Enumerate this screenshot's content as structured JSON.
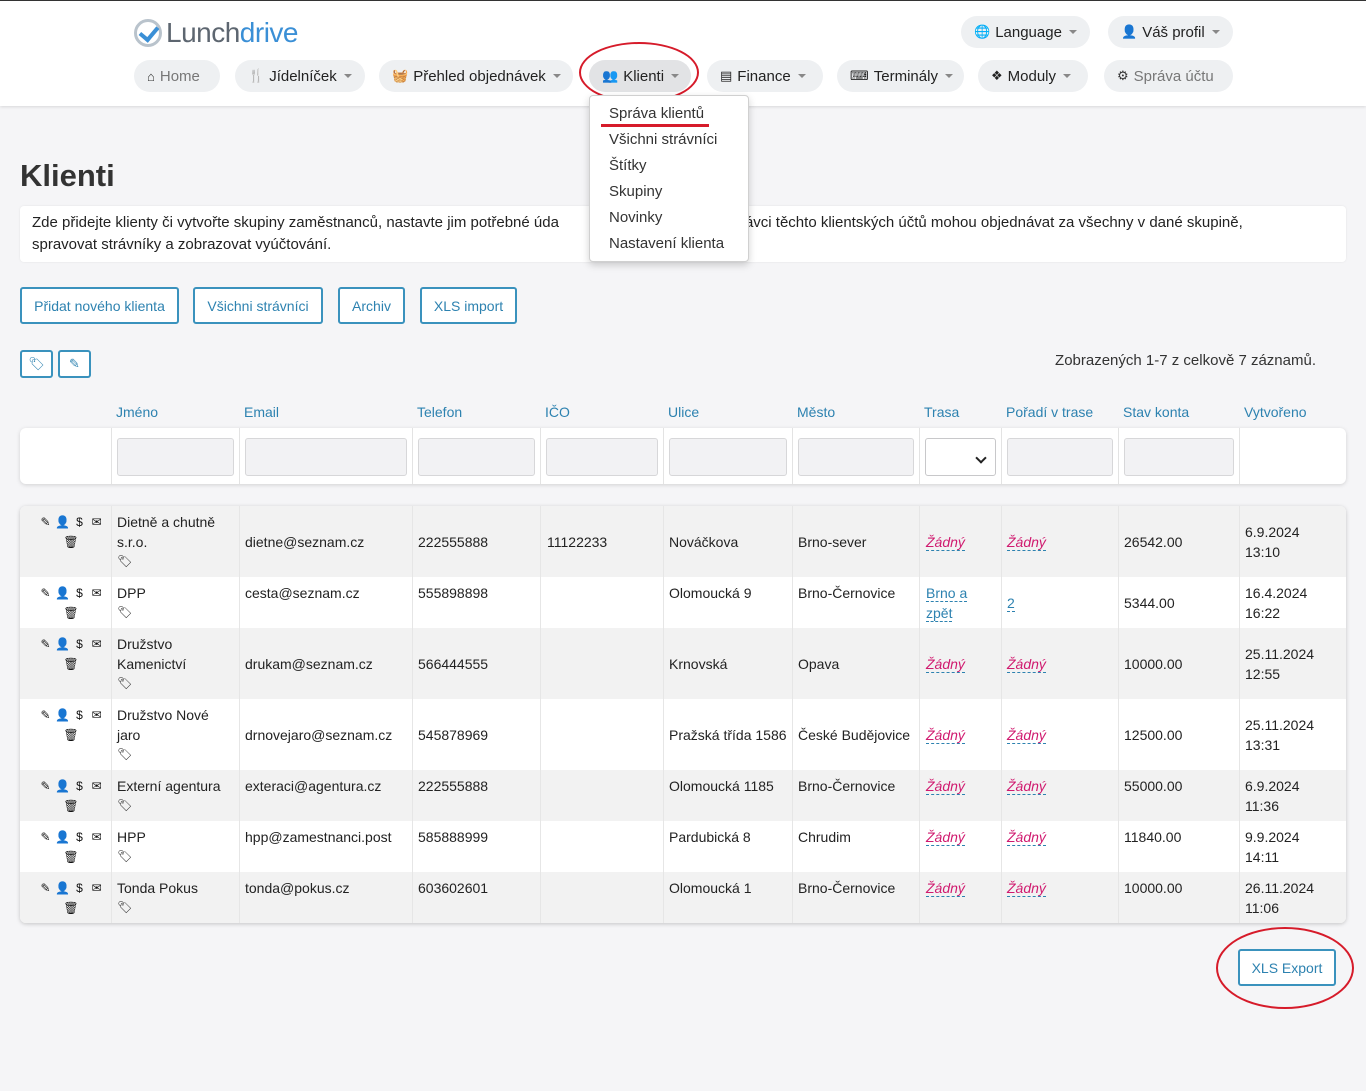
{
  "brand": {
    "part1": "Lunch",
    "part2": "drive"
  },
  "top_right": {
    "language": "Language",
    "profile": "Váš profil"
  },
  "nav": {
    "home": "Home",
    "menu": "Jídelníček",
    "orders": "Přehled objednávek",
    "clients": "Klienti",
    "finance": "Finance",
    "terminals": "Terminály",
    "modules": "Moduly",
    "account": "Správa účtu"
  },
  "clients_menu": [
    "Správa klientů",
    "Všichni strávníci",
    "Štítky",
    "Skupiny",
    "Novinky",
    "Nastavení klienta"
  ],
  "page": {
    "title": "Klienti",
    "intro_line1": "Zde přidejte klienty či vytvořte skupiny zaměstnanců, nastavte jim potřebné úda",
    "intro_line1b": "e. Správci těchto klientských účtů mohou objednávat za všechny v dané skupině,",
    "intro_line2": "spravovat strávníky a zobrazovat vyúčtování."
  },
  "actions": {
    "add_client": "Přidat nového klienta",
    "all_diners": "Všichni strávníci",
    "archive": "Archiv",
    "xls_import": "XLS import",
    "xls_export": "XLS Export"
  },
  "records_text": "Zobrazených 1-7 z celkově 7 záznamů.",
  "columns": [
    "Jméno",
    "Email",
    "Telefon",
    "IČO",
    "Ulice",
    "Město",
    "Trasa",
    "Pořadí v trase",
    "Stav konta",
    "Vytvořeno"
  ],
  "rows": [
    {
      "name1": "Dietně a chutně",
      "name2": "s.r.o.",
      "email": "dietne@seznam.cz",
      "phone": "222555888",
      "ico": "11122233",
      "street": "Nováčkova",
      "city": "Brno-sever",
      "route1": "Žádný",
      "route2": "",
      "order": "Žádný",
      "balance": "26542.00",
      "date": "6.9.2024",
      "time": "13:10"
    },
    {
      "name1": "DPP",
      "name2": "",
      "email": "cesta@seznam.cz",
      "phone": "555898898",
      "ico": "",
      "street": "Olomoucká 9",
      "city": "Brno-Černovice",
      "route1": "Brno a",
      "route2": "zpět",
      "order": "2",
      "balance": "5344.00",
      "date": "16.4.2024",
      "time": "16:22"
    },
    {
      "name1": "Družstvo",
      "name2": "Kamenictví",
      "email": "drukam@seznam.cz",
      "phone": "566444555",
      "ico": "",
      "street": "Krnovská",
      "city": "Opava",
      "route1": "Žádný",
      "route2": "",
      "order": "Žádný",
      "balance": "10000.00",
      "date": "25.11.2024",
      "time": "12:55"
    },
    {
      "name1": "Družstvo Nové",
      "name2": "jaro",
      "email": "drnovejaro@seznam.cz",
      "phone": "545878969",
      "ico": "",
      "street": "Pražská třída 1586",
      "city": "České Budějovice",
      "route1": "Žádný",
      "route2": "",
      "order": "Žádný",
      "balance": "12500.00",
      "date": "25.11.2024",
      "time": "13:31"
    },
    {
      "name1": "Externí agentura",
      "name2": "",
      "email": "exteraci@agentura.cz",
      "phone": "222555888",
      "ico": "",
      "street": "Olomoucká 1185",
      "city": "Brno-Černovice",
      "route1": "Žádný",
      "route2": "",
      "order": "Žádný",
      "balance": "55000.00",
      "date": "6.9.2024",
      "time": "11:36"
    },
    {
      "name1": "HPP",
      "name2": "",
      "email": "hpp@zamestnanci.post",
      "phone": "585888999",
      "ico": "",
      "street": "Pardubická 8",
      "city": "Chrudim",
      "route1": "Žádný",
      "route2": "",
      "order": "Žádný",
      "balance": "11840.00",
      "date": "9.9.2024",
      "time": "14:11"
    },
    {
      "name1": "Tonda Pokus",
      "name2": "",
      "email": "tonda@pokus.cz",
      "phone": "603602601",
      "ico": "",
      "street": "Olomoucká 1",
      "city": "Brno-Černovice",
      "route1": "Žádný",
      "route2": "",
      "order": "Žádný",
      "balance": "10000.00",
      "date": "26.11.2024",
      "time": "11:06"
    }
  ]
}
